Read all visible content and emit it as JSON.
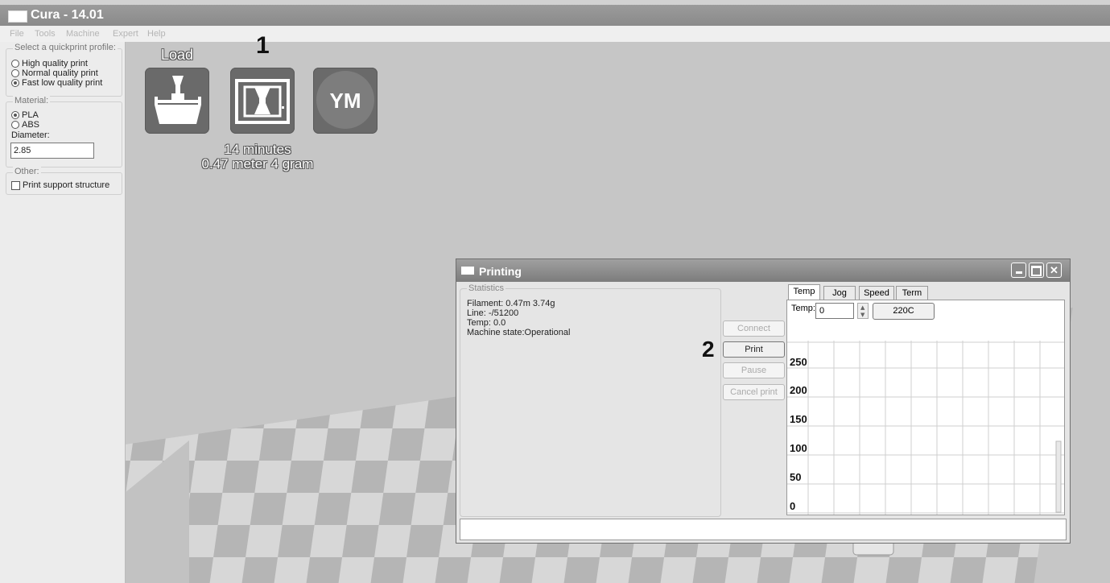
{
  "window": {
    "title": "Cura - 14.01"
  },
  "menu": [
    "File",
    "Tools",
    "Machine",
    "Expert",
    "Help"
  ],
  "sidebar": {
    "profile_title": "Select a quickprint profile:",
    "profiles": [
      {
        "label": "High quality print",
        "selected": false
      },
      {
        "label": "Normal quality print",
        "selected": false
      },
      {
        "label": "Fast low quality print",
        "selected": true
      }
    ],
    "material_title": "Material:",
    "materials": [
      {
        "label": "PLA",
        "selected": true
      },
      {
        "label": "ABS",
        "selected": false
      }
    ],
    "diameter_label": "Diameter:",
    "diameter_value": "2.85",
    "other_title": "Other:",
    "support_label": "Print support structure",
    "support_checked": false
  },
  "toolbar": {
    "load_label": "Load",
    "ym_label": "YM",
    "print_time": "14 minutes",
    "print_material": "0.47 meter 4 gram"
  },
  "annotations": {
    "one": "1",
    "two": "2"
  },
  "print_dialog": {
    "title": "Printing",
    "stats_title": "Statistics",
    "stats": [
      "Filament: 0.47m 3.74g",
      "Line: -/51200",
      "Temp: 0.0",
      "Machine state:Operational"
    ],
    "buttons": {
      "connect": "Connect",
      "print": "Print",
      "pause": "Pause",
      "cancel": "Cancel print"
    },
    "tabs": [
      "Temp",
      "Jog",
      "Speed",
      "Term"
    ],
    "selected_tab": "Temp",
    "temp_label": "Temp:",
    "temp_value": "0",
    "preset_button": "220C",
    "graph_labels": [
      "250",
      "200",
      "150",
      "100",
      "50",
      "0"
    ],
    "status_text": ""
  },
  "colors": {
    "titlebar": "#8f8f8f",
    "dialog_title": "#7f7f7f",
    "icon_tile": "#6a6a6a",
    "floor_light": "#d9d9d9",
    "floor_dark": "#b3b3b3"
  }
}
